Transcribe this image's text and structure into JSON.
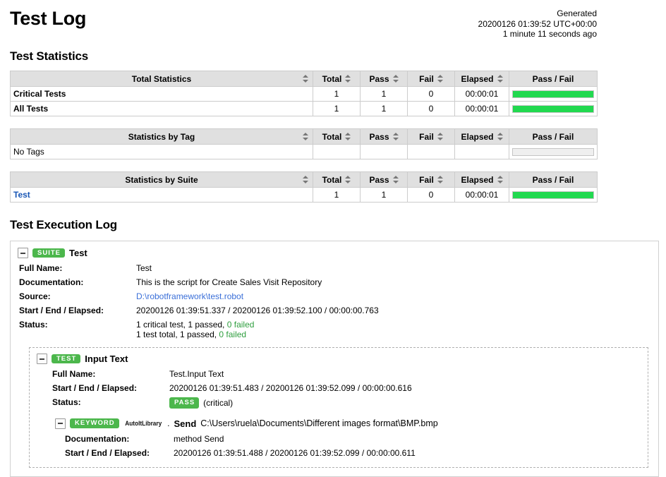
{
  "header": {
    "title": "Test Log",
    "generated_label": "Generated",
    "generated_time": "20200126 01:39:52 UTC+00:00",
    "generated_ago": "1 minute 11 seconds ago"
  },
  "statistics": {
    "section_title": "Test Statistics",
    "columns": [
      "Total",
      "Pass",
      "Fail",
      "Elapsed",
      "Pass / Fail"
    ],
    "tables": [
      {
        "name_header": "Total Statistics",
        "rows": [
          {
            "name": "Critical Tests",
            "link": false,
            "bold": true,
            "total": "1",
            "pass": "1",
            "fail": "0",
            "elapsed": "00:00:01",
            "pass_pct": 100,
            "has_bar": true
          },
          {
            "name": "All Tests",
            "link": false,
            "bold": true,
            "total": "1",
            "pass": "1",
            "fail": "0",
            "elapsed": "00:00:01",
            "pass_pct": 100,
            "has_bar": true
          }
        ]
      },
      {
        "name_header": "Statistics by Tag",
        "rows": [
          {
            "name": "No Tags",
            "link": false,
            "bold": false,
            "total": "",
            "pass": "",
            "fail": "",
            "elapsed": "",
            "pass_pct": 0,
            "has_bar": true
          }
        ]
      },
      {
        "name_header": "Statistics by Suite",
        "rows": [
          {
            "name": "Test",
            "link": true,
            "bold": true,
            "total": "1",
            "pass": "1",
            "fail": "0",
            "elapsed": "00:00:01",
            "pass_pct": 100,
            "has_bar": true
          }
        ]
      }
    ]
  },
  "execution": {
    "section_title": "Test Execution Log",
    "suite": {
      "badge": "SUITE",
      "name": "Test",
      "toggle": "-",
      "meta": [
        {
          "label": "Full Name:",
          "value": "Test",
          "type": "text"
        },
        {
          "label": "Documentation:",
          "value": "This is the script for Create Sales Visit Repository",
          "type": "text"
        },
        {
          "label": "Source:",
          "value": "D:\\robotframework\\test.robot",
          "type": "link"
        },
        {
          "label": "Start / End / Elapsed:",
          "value": "20200126 01:39:51.337 / 20200126 01:39:52.100 / 00:00:00.763",
          "type": "text"
        },
        {
          "label": "Status:",
          "type": "status2",
          "line1_a": "1 critical test, 1 passed, ",
          "line1_b": "0 failed",
          "line2_a": "1 test total, 1 passed, ",
          "line2_b": "0 failed"
        }
      ],
      "test": {
        "badge": "TEST",
        "name": "Input Text",
        "toggle": "-",
        "meta": [
          {
            "label": "Full Name:",
            "value": "Test.Input Text",
            "type": "text"
          },
          {
            "label": "Start / End / Elapsed:",
            "value": "20200126 01:39:51.483 / 20200126 01:39:52.099 / 00:00:00.616",
            "type": "text"
          }
        ],
        "status_label": "Status:",
        "status_badge": "PASS",
        "status_suffix": "(critical)",
        "keyword": {
          "badge": "KEYWORD",
          "library": "AutoItLibrary",
          "separator": ".",
          "name": "Send",
          "args": "C:\\Users\\ruela\\Documents\\Different images format\\BMP.bmp",
          "toggle": "-",
          "meta": [
            {
              "label": "Documentation:",
              "value": "method Send",
              "type": "text"
            },
            {
              "label": "Start / End / Elapsed:",
              "value": "20200126 01:39:51.488 / 20200126 01:39:52.099 / 00:00:00.611",
              "type": "text"
            }
          ]
        }
      }
    }
  },
  "colors": {
    "pass_green": "#21d94f",
    "badge_green": "#4cb74c",
    "link_blue": "#1a57b5",
    "source_blue": "#3a6fd8",
    "status_green": "#2e9e3e"
  }
}
